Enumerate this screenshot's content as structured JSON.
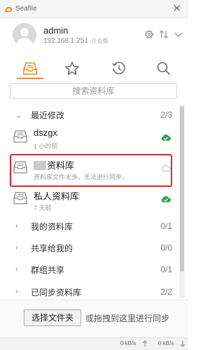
{
  "window": {
    "title": "Seafile"
  },
  "account": {
    "name": "admin",
    "server": "192.168.1.251",
    "edition": "企业版"
  },
  "tabs": [
    {
      "name": "libraries",
      "active": true
    },
    {
      "name": "starred",
      "active": false
    },
    {
      "name": "activities",
      "active": false
    },
    {
      "name": "search",
      "active": false
    }
  ],
  "search": {
    "placeholder": "搜索资料库"
  },
  "sections": {
    "recent": {
      "label": "最近修改",
      "count": "2/3"
    },
    "mine": {
      "label": "我的资料库",
      "count": "0/1"
    },
    "shared": {
      "label": "共享给我的",
      "count": "0/0"
    },
    "group": {
      "label": "群组共享",
      "count": "0/1"
    },
    "synced": {
      "label": "已同步资料库",
      "count": "2/2"
    }
  },
  "repos": [
    {
      "name": "dszgx",
      "sub": "1 小时前",
      "status": "synced"
    },
    {
      "name": "资料库",
      "sub": "资料库文件太多，无法进行同步。",
      "status": "not-synced"
    },
    {
      "name": "私人资料库",
      "sub": "7 天前",
      "status": "synced"
    }
  ],
  "bottom": {
    "select_button": "选择文件夹",
    "drag_hint": "或拖拽到这里进行同步"
  },
  "status": {
    "upload": "0 kB/s",
    "download": "0 kB/s"
  },
  "colors": {
    "accent": "#f08c20",
    "synced": "#2aa84a",
    "highlight": "#e3242b"
  }
}
